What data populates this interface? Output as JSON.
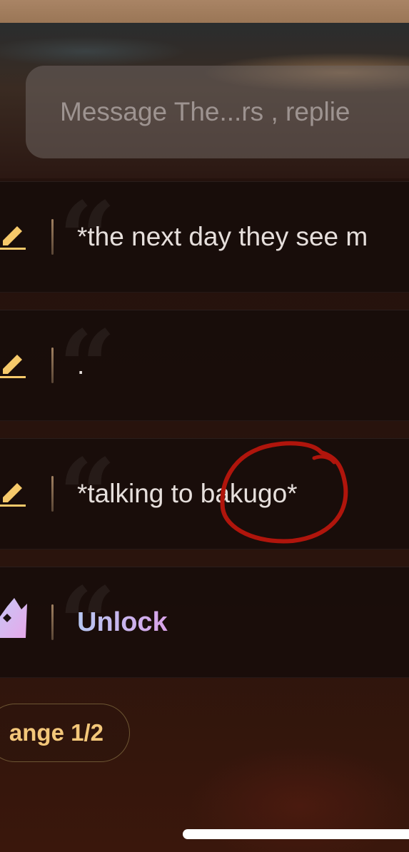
{
  "composer": {
    "placeholder": "Message The...rs , replie"
  },
  "replies": [
    {
      "text": "*the next day they see m",
      "icon": "pencil-icon"
    },
    {
      "text": ".",
      "icon": "pencil-icon"
    },
    {
      "text": "*talking to bakugo*",
      "icon": "pencil-icon"
    }
  ],
  "premium": {
    "label": "Unlock",
    "icon": "crown-icon"
  },
  "change_button": {
    "label": "ange 1/2"
  },
  "colors": {
    "accent_gold": "#f3c77a",
    "annotation_red": "#b0150c",
    "unlock_gradient_start": "#b7c7f2",
    "unlock_gradient_end": "#d9a3e9"
  }
}
